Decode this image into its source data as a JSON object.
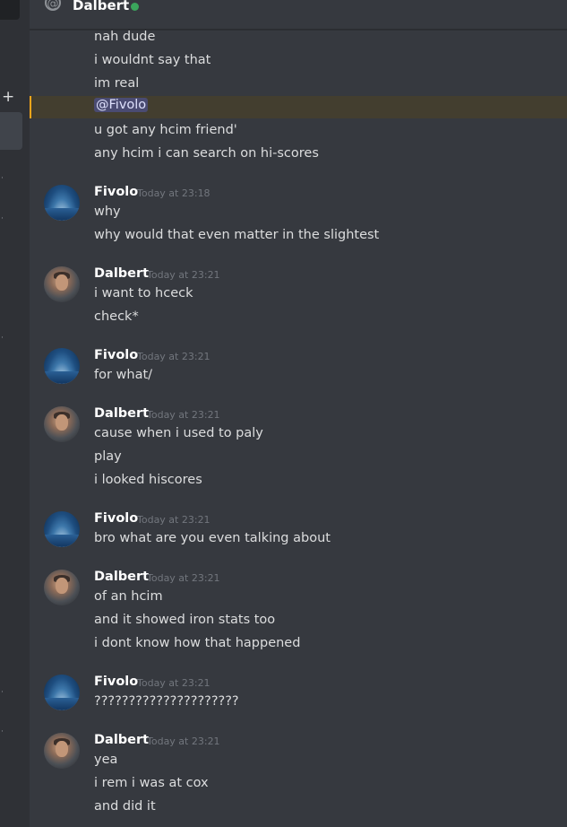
{
  "header": {
    "channel_name": "Dalbert",
    "status_color": "#3ba55c"
  },
  "mention_text": "@Fivolo",
  "first_group": {
    "lines": [
      "nah dude",
      "i wouldnt say that",
      "im real",
      "u got any hcim friend'",
      "any hcim i can search on hi-scores"
    ]
  },
  "messages": [
    {
      "author": "Fivolo",
      "timestamp": "Today at 23:18",
      "lines": [
        "why",
        "why would that even matter in the slightest"
      ]
    },
    {
      "author": "Dalbert",
      "timestamp": "Today at 23:21",
      "lines": [
        "i want to hceck",
        "check*"
      ]
    },
    {
      "author": "Fivolo",
      "timestamp": "Today at 23:21",
      "lines": [
        "for what/"
      ]
    },
    {
      "author": "Dalbert",
      "timestamp": "Today at 23:21",
      "lines": [
        "cause when i used to paly",
        "play",
        "i looked hiscores"
      ]
    },
    {
      "author": "Fivolo",
      "timestamp": "Today at 23:21",
      "lines": [
        "bro what are you even talking about"
      ]
    },
    {
      "author": "Dalbert",
      "timestamp": "Today at 23:21",
      "lines": [
        "of an hcim",
        "and it showed iron stats too",
        "i dont know how that happened"
      ]
    },
    {
      "author": "Fivolo",
      "timestamp": "Today at 23:21",
      "lines": [
        "?????????????????????"
      ]
    },
    {
      "author": "Dalbert",
      "timestamp": "Today at 23:21",
      "lines": [
        "yea",
        "i rem i was at cox",
        "and did it"
      ]
    }
  ],
  "sidebar": {
    "plus_icon": "+"
  }
}
